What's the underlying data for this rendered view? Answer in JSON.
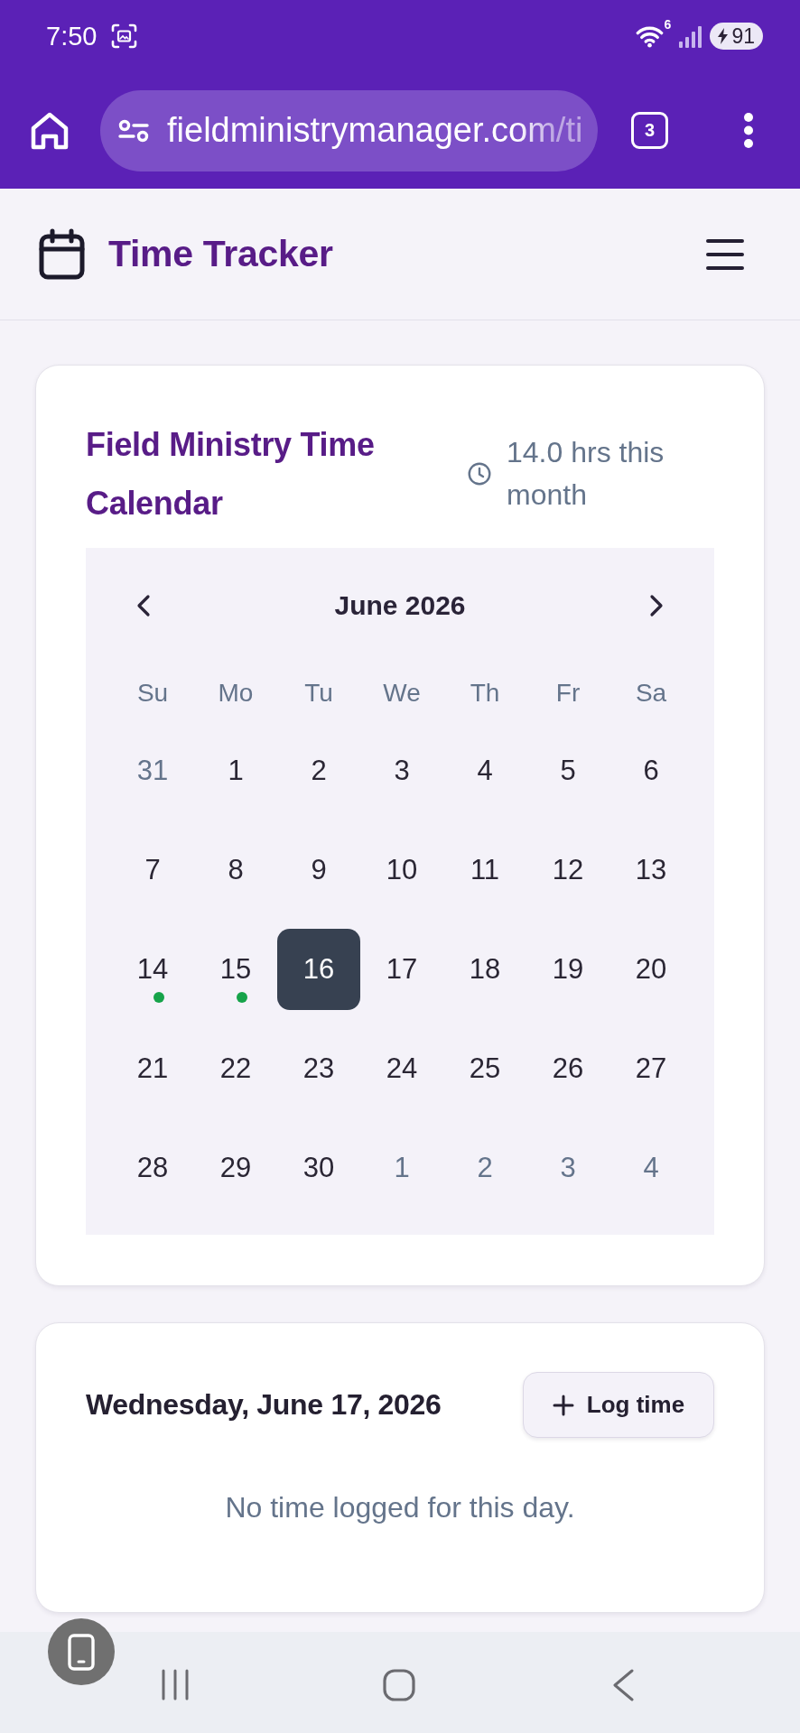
{
  "status_bar": {
    "time": "7:50",
    "network_type": "6",
    "battery": "91"
  },
  "browser": {
    "url": "fieldministrymanager.com/ti",
    "tab_count": "3"
  },
  "header": {
    "title": "Time Tracker"
  },
  "calendar": {
    "title": "Field Ministry Time Calendar",
    "monthly_total": "14.0 hrs this month",
    "month": "June 2026",
    "weekdays": [
      "Su",
      "Mo",
      "Tu",
      "We",
      "Th",
      "Fr",
      "Sa"
    ],
    "days": [
      {
        "label": "31",
        "outside_month": true,
        "selected": false,
        "logged": false
      },
      {
        "label": "1",
        "outside_month": false,
        "selected": false,
        "logged": false
      },
      {
        "label": "2",
        "outside_month": false,
        "selected": false,
        "logged": false
      },
      {
        "label": "3",
        "outside_month": false,
        "selected": false,
        "logged": false
      },
      {
        "label": "4",
        "outside_month": false,
        "selected": false,
        "logged": false
      },
      {
        "label": "5",
        "outside_month": false,
        "selected": false,
        "logged": false
      },
      {
        "label": "6",
        "outside_month": false,
        "selected": false,
        "logged": false
      },
      {
        "label": "7",
        "outside_month": false,
        "selected": false,
        "logged": false
      },
      {
        "label": "8",
        "outside_month": false,
        "selected": false,
        "logged": false
      },
      {
        "label": "9",
        "outside_month": false,
        "selected": false,
        "logged": false
      },
      {
        "label": "10",
        "outside_month": false,
        "selected": false,
        "logged": false
      },
      {
        "label": "11",
        "outside_month": false,
        "selected": false,
        "logged": false
      },
      {
        "label": "12",
        "outside_month": false,
        "selected": false,
        "logged": false
      },
      {
        "label": "13",
        "outside_month": false,
        "selected": false,
        "logged": false
      },
      {
        "label": "14",
        "outside_month": false,
        "selected": false,
        "logged": true
      },
      {
        "label": "15",
        "outside_month": false,
        "selected": false,
        "logged": true
      },
      {
        "label": "16",
        "outside_month": false,
        "selected": true,
        "logged": false
      },
      {
        "label": "17",
        "outside_month": false,
        "selected": false,
        "logged": false
      },
      {
        "label": "18",
        "outside_month": false,
        "selected": false,
        "logged": false
      },
      {
        "label": "19",
        "outside_month": false,
        "selected": false,
        "logged": false
      },
      {
        "label": "20",
        "outside_month": false,
        "selected": false,
        "logged": false
      },
      {
        "label": "21",
        "outside_month": false,
        "selected": false,
        "logged": false
      },
      {
        "label": "22",
        "outside_month": false,
        "selected": false,
        "logged": false
      },
      {
        "label": "23",
        "outside_month": false,
        "selected": false,
        "logged": false
      },
      {
        "label": "24",
        "outside_month": false,
        "selected": false,
        "logged": false
      },
      {
        "label": "25",
        "outside_month": false,
        "selected": false,
        "logged": false
      },
      {
        "label": "26",
        "outside_month": false,
        "selected": false,
        "logged": false
      },
      {
        "label": "27",
        "outside_month": false,
        "selected": false,
        "logged": false
      },
      {
        "label": "28",
        "outside_month": false,
        "selected": false,
        "logged": false
      },
      {
        "label": "29",
        "outside_month": false,
        "selected": false,
        "logged": false
      },
      {
        "label": "30",
        "outside_month": false,
        "selected": false,
        "logged": false
      },
      {
        "label": "1",
        "outside_month": true,
        "selected": false,
        "logged": false
      },
      {
        "label": "2",
        "outside_month": true,
        "selected": false,
        "logged": false
      },
      {
        "label": "3",
        "outside_month": true,
        "selected": false,
        "logged": false
      },
      {
        "label": "4",
        "outside_month": true,
        "selected": false,
        "logged": false
      }
    ]
  },
  "day_panel": {
    "date": "Wednesday, June 17, 2026",
    "button": "Log time",
    "empty_message": "No time logged for this day."
  }
}
